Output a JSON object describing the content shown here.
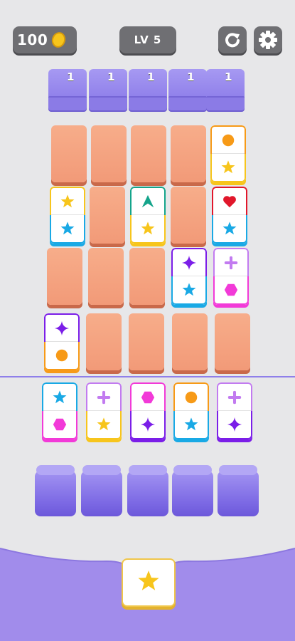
{
  "hud": {
    "coins": "100",
    "level": "LV 5"
  },
  "counters": [
    "1",
    "1",
    "1",
    "1",
    "1"
  ],
  "colors": {
    "orange": "#f79a17",
    "yellow": "#f7c51c",
    "teal": "#14a48b",
    "red": "#e1172b",
    "blue": "#19a9e5",
    "purple": "#7b1ee8",
    "lilac": "#c27bf0",
    "pink": "#f23ad8"
  },
  "board": [
    [
      "blank",
      "blank",
      "blank",
      "blank",
      {
        "top": "circle",
        "bot": "star"
      }
    ],
    [
      {
        "top": "star",
        "bot": "star-blue"
      },
      "blank",
      {
        "top": "arrow",
        "bot": "star"
      },
      "blank",
      {
        "top": "heart",
        "bot": "star-blue"
      }
    ],
    [
      "blank",
      "blank",
      "blank",
      {
        "top": "sparkle",
        "bot": "star-blue"
      },
      {
        "top": "plus",
        "bot": "hexagon"
      }
    ],
    [
      {
        "top": "sparkle",
        "bot": "circle"
      },
      "blank",
      "blank",
      "blank",
      "blank"
    ]
  ],
  "queue": [
    {
      "top": "star-blue",
      "bot": "hexagon"
    },
    {
      "top": "plus",
      "bot": "star"
    },
    {
      "top": "hexagon",
      "bot": "sparkle"
    },
    {
      "top": "circle",
      "bot": "star-blue"
    },
    {
      "top": "plus",
      "bot": "sparkle"
    }
  ],
  "held_tile": "star"
}
